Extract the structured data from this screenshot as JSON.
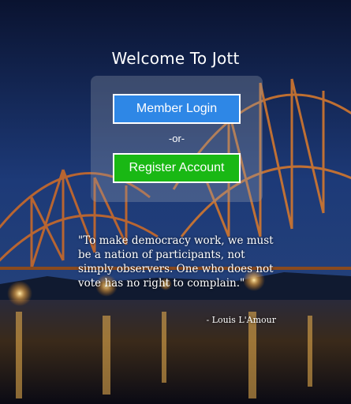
{
  "page": {
    "welcome_title": "Welcome To Jott"
  },
  "login_panel": {
    "login_label": "Member Login",
    "separator": "-or-",
    "register_label": "Register Account"
  },
  "quote": {
    "text": "\"To make democracy work, we must be a nation of participants, not simply observers. One who does not vote has no right to complain.\"",
    "author": "- Louis L'Amour"
  },
  "colors": {
    "login_button": "#2e87e6",
    "register_button": "#19b814",
    "text": "#ffffff"
  }
}
